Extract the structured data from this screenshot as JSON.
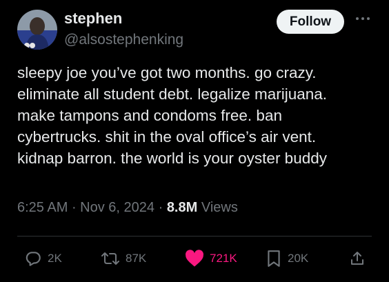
{
  "author": {
    "name": "stephen",
    "handle": "@alsostephenking"
  },
  "follow_label": "Follow",
  "tweet_lines": [
    "sleepy joe you’ve got two months. go crazy.",
    "eliminate all student debt. legalize marijuana.",
    "make tampons and condoms free. ban",
    "cybertrucks. shit in the oval office’s air vent.",
    "kidnap barron. the world is your oyster buddy"
  ],
  "meta": {
    "time": "6:25 AM",
    "separator1": " · ",
    "date": "Nov 6, 2024",
    "separator2": " · ",
    "views_count": "8.8M",
    "views_label": " Views"
  },
  "actions": {
    "replies": "2K",
    "reposts": "87K",
    "likes": "721K",
    "bookmarks": "20K"
  },
  "colors": {
    "like": "#f91880",
    "muted": "#71767b",
    "text": "#e7e9ea"
  },
  "icons": {
    "reply": "reply-icon",
    "repost": "repost-icon",
    "like": "heart-icon",
    "bookmark": "bookmark-icon",
    "share": "share-icon",
    "more": "more-icon"
  }
}
